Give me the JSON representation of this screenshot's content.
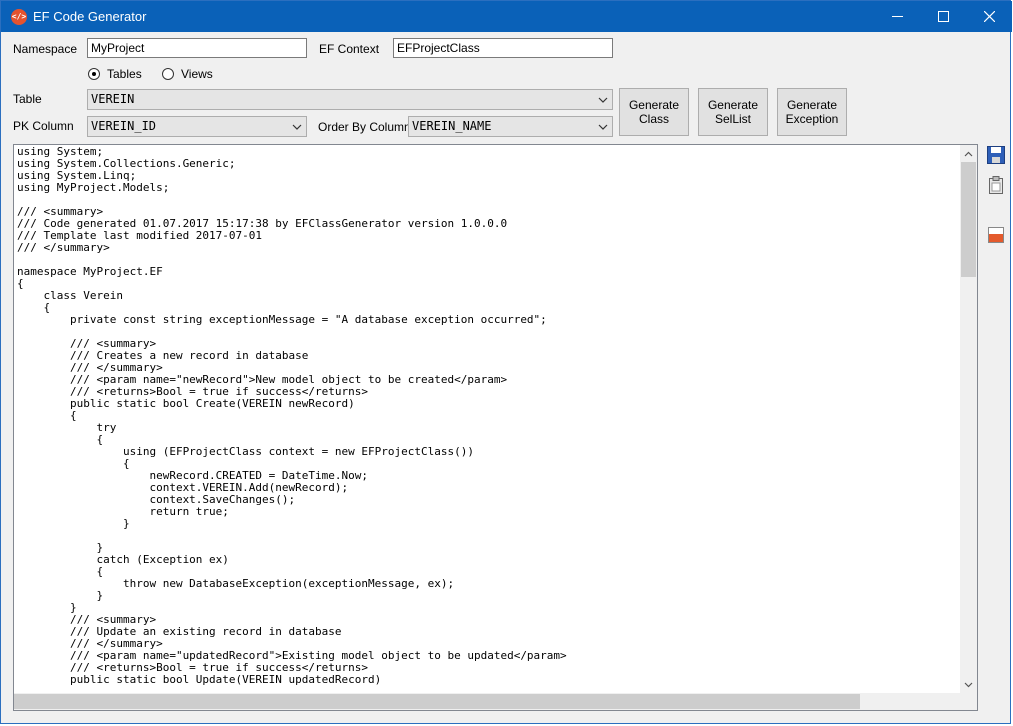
{
  "window": {
    "title": "EF Code Generator"
  },
  "labels": {
    "namespace": "Namespace",
    "ef_context": "EF Context",
    "table": "Table",
    "pk_column": "PK Column",
    "order_by_column": "Order By Column"
  },
  "fields": {
    "namespace_value": "MyProject",
    "ef_context_value": "EFProjectClass"
  },
  "source_type": {
    "options": [
      "Tables",
      "Views"
    ],
    "selected": "Tables"
  },
  "combos": {
    "table": "VEREIN",
    "pk_column": "VEREIN_ID",
    "order_by_column": "VEREIN_NAME"
  },
  "buttons": {
    "generate_class": "Generate\nClass",
    "generate_sellist": "Generate\nSelList",
    "generate_exception": "Generate\nException"
  },
  "icons": {
    "app": "code-icon",
    "side": [
      "save-icon",
      "clipboard-icon",
      "export-icon"
    ]
  },
  "code_text": "using System;\nusing System.Collections.Generic;\nusing System.Linq;\nusing MyProject.Models;\n\n/// <summary>\n/// Code generated 01.07.2017 15:17:38 by EFClassGenerator version 1.0.0.0\n/// Template last modified 2017-07-01\n/// </summary>\n\nnamespace MyProject.EF\n{\n    class Verein\n    {\n        private const string exceptionMessage = \"A database exception occurred\";\n\n        /// <summary>\n        /// Creates a new record in database\n        /// </summary>\n        /// <param name=\"newRecord\">New model object to be created</param>\n        /// <returns>Bool = true if success</returns>\n        public static bool Create(VEREIN newRecord)\n        {\n            try\n            {\n                using (EFProjectClass context = new EFProjectClass())\n                {\n                    newRecord.CREATED = DateTime.Now;\n                    context.VEREIN.Add(newRecord);\n                    context.SaveChanges();\n                    return true;\n                }\n\n            }\n            catch (Exception ex)\n            {\n                throw new DatabaseException(exceptionMessage, ex);\n            }\n        }\n        /// <summary>\n        /// Update an existing record in database\n        /// </summary>\n        /// <param name=\"updatedRecord\">Existing model object to be updated</param>\n        /// <returns>Bool = true if success</returns>\n        public static bool Update(VEREIN updatedRecord)"
}
